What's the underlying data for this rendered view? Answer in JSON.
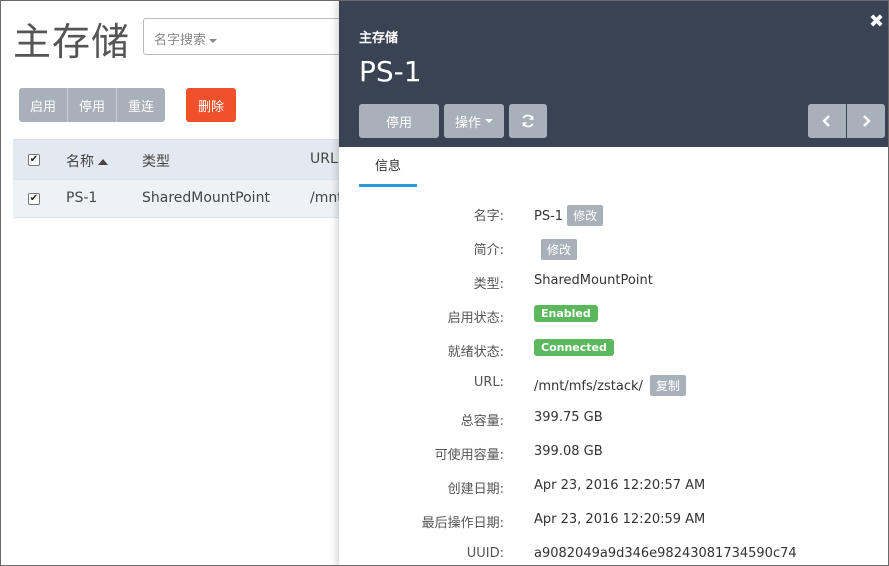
{
  "list_page": {
    "title": "主存储",
    "search": {
      "placeholder": "名字搜索"
    },
    "actions": {
      "enable": "启用",
      "disable": "停用",
      "reconnect": "重连",
      "delete": "删除"
    },
    "table": {
      "headers": {
        "name": "名称",
        "type": "类型",
        "url": "URL"
      },
      "rows": [
        {
          "name": "PS-1",
          "type": "SharedMountPoint",
          "url": "/mnt"
        }
      ]
    }
  },
  "detail": {
    "subtitle": "主存储",
    "title": "PS-1",
    "buttons": {
      "disable": "停用",
      "actions": "操作",
      "refresh_icon": "refresh-icon",
      "prev_icon": "chevron-left-icon",
      "next_icon": "chevron-right-icon",
      "close_icon": "close-icon"
    },
    "tabs": [
      "信息"
    ],
    "info": {
      "name": {
        "label": "名字:",
        "value": "PS-1",
        "edit": "修改"
      },
      "description": {
        "label": "简介:",
        "edit": "修改"
      },
      "type": {
        "label": "类型:",
        "value": "SharedMountPoint"
      },
      "state": {
        "label": "启用状态:",
        "value": "Enabled"
      },
      "status": {
        "label": "就绪状态:",
        "value": "Connected"
      },
      "url": {
        "label": "URL:",
        "value": "/mnt/mfs/zstack/",
        "copy": "复制"
      },
      "total_capacity": {
        "label": "总容量:",
        "value": "399.75 GB"
      },
      "available_capacity": {
        "label": "可使用容量:",
        "value": "399.08 GB"
      },
      "create_date": {
        "label": "创建日期:",
        "value": "Apr 23, 2016 12:20:57 AM"
      },
      "last_op_date": {
        "label": "最后操作日期:",
        "value": "Apr 23, 2016 12:20:59 AM"
      },
      "uuid": {
        "label": "UUID:",
        "value": "a9082049a9d346e98243081734590c74"
      }
    }
  },
  "colors": {
    "header_bg": "#3a4354",
    "tab_accent": "#2b9ad8",
    "button_gray": "#a8b0b9",
    "danger": "#f0502a",
    "success": "#5cb85c"
  }
}
